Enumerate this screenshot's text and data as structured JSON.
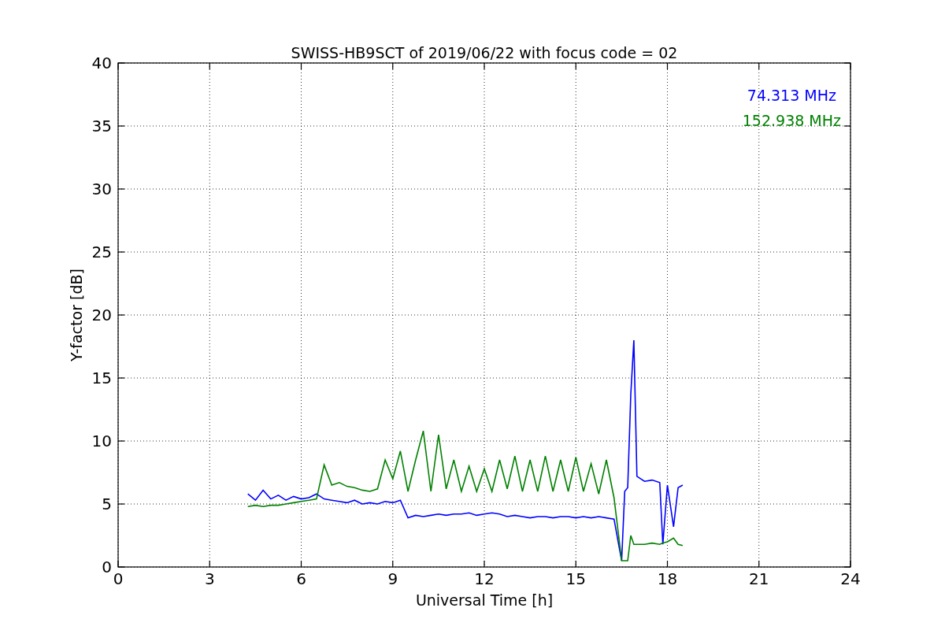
{
  "chart_data": {
    "type": "line",
    "title": "SWISS-HB9SCT of 2019/06/22 with focus code = 02",
    "xlabel": "Universal Time [h]",
    "ylabel": "Y-factor [dB]",
    "grid": true,
    "xlim": [
      0,
      24
    ],
    "ylim": [
      0,
      40
    ],
    "xticks": [
      0,
      3,
      6,
      9,
      12,
      15,
      18,
      21,
      24
    ],
    "yticks": [
      0,
      5,
      10,
      15,
      20,
      25,
      30,
      35,
      40
    ],
    "x": [
      4.25,
      4.5,
      4.75,
      5,
      5.25,
      5.5,
      5.75,
      6,
      6.25,
      6.5,
      6.75,
      7,
      7.25,
      7.5,
      7.75,
      8,
      8.25,
      8.5,
      8.75,
      9,
      9.25,
      9.5,
      9.75,
      10,
      10.25,
      10.5,
      10.75,
      11,
      11.25,
      11.5,
      11.75,
      12,
      12.25,
      12.5,
      12.75,
      13,
      13.25,
      13.5,
      13.75,
      14,
      14.25,
      14.5,
      14.75,
      15,
      15.25,
      15.5,
      15.75,
      16,
      16.25,
      16.5,
      16.6,
      16.7,
      16.8,
      16.9,
      17,
      17.25,
      17.5,
      17.75,
      17.85,
      18,
      18.2,
      18.35,
      18.5
    ],
    "series": [
      {
        "name": "74.313 MHz",
        "color": "#0000ff",
        "values": [
          5.8,
          5.3,
          6.1,
          5.4,
          5.7,
          5.3,
          5.6,
          5.4,
          5.5,
          5.8,
          5.4,
          5.3,
          5.2,
          5.1,
          5.3,
          5.0,
          5.1,
          5.0,
          5.2,
          5.1,
          5.3,
          3.9,
          4.1,
          4.0,
          4.1,
          4.2,
          4.1,
          4.2,
          4.2,
          4.3,
          4.1,
          4.2,
          4.3,
          4.2,
          4.0,
          4.1,
          4.0,
          3.9,
          4.0,
          4.0,
          3.9,
          4.0,
          4.0,
          3.9,
          4.0,
          3.9,
          4.0,
          3.9,
          3.8,
          0.5,
          6.0,
          6.3,
          13.7,
          18.0,
          7.2,
          6.8,
          6.9,
          6.7,
          1.8,
          6.5,
          3.2,
          6.3,
          6.5
        ]
      },
      {
        "name": "152.938 MHz",
        "color": "#008000",
        "values": [
          4.8,
          4.9,
          4.8,
          4.9,
          4.9,
          5.0,
          5.1,
          5.2,
          5.3,
          5.4,
          8.1,
          6.5,
          6.7,
          6.4,
          6.3,
          6.1,
          6.0,
          6.2,
          8.5,
          7.0,
          9.2,
          6.0,
          8.5,
          10.8,
          6.0,
          10.5,
          6.2,
          8.5,
          6.0,
          8.0,
          6.0,
          7.8,
          6.0,
          8.5,
          6.2,
          8.8,
          6.0,
          8.5,
          6.0,
          8.8,
          6.0,
          8.5,
          6.0,
          8.7,
          6.0,
          8.2,
          5.8,
          8.5,
          5.5,
          0.5,
          0.5,
          0.5,
          2.5,
          1.8,
          1.8,
          1.8,
          1.9,
          1.8,
          1.9,
          2.0,
          2.3,
          1.8,
          1.7
        ]
      }
    ]
  }
}
